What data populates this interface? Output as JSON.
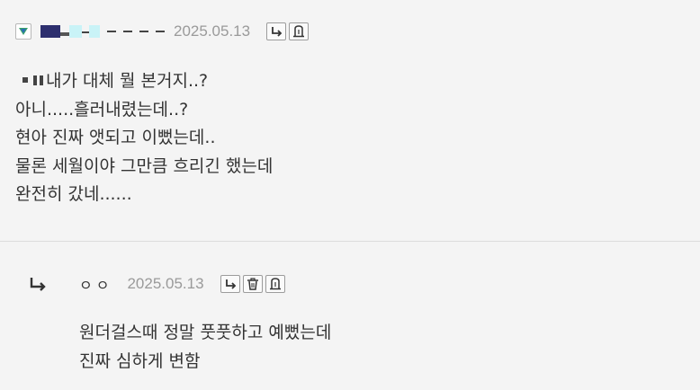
{
  "comments": [
    {
      "date": "2025.05.13",
      "lines": [
        "내가 대체 뭘 본거지..?",
        "아니.....흘러내렸는데..?",
        "현아 진짜 앳되고 이뻤는데..",
        "물론 세월이야 그만큼 흐리긴 했는데",
        "완전히 갔네......"
      ],
      "buttons": [
        "reply-icon",
        "report-icon"
      ]
    },
    {
      "nickname": "ㅇㅇ",
      "date": "2025.05.13",
      "lines": [
        "원더걸스때 정말 풋풋하고 예뻤는데",
        "진짜 심하게 변함"
      ],
      "buttons": [
        "reply-icon",
        "trash-icon",
        "report-icon"
      ]
    }
  ],
  "colors": {
    "background": "#f4f4f4",
    "date": "#9a9a9a",
    "text": "#333333",
    "divider": "#dcdcdc"
  }
}
